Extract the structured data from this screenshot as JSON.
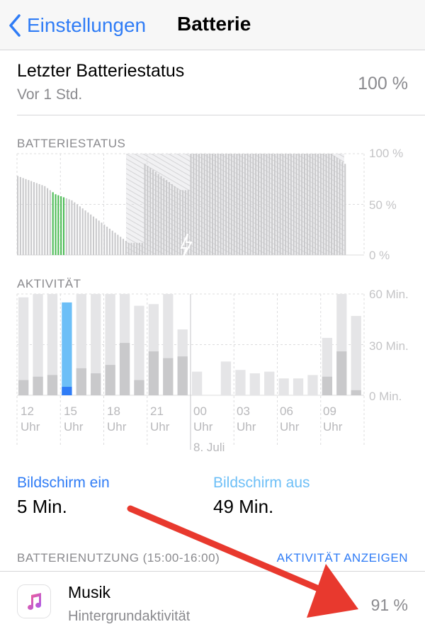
{
  "nav": {
    "back_label": "Einstellungen",
    "title": "Batterie",
    "accent": "#2f7cf6"
  },
  "last_status": {
    "title": "Letzter Batteriestatus",
    "subtitle": "Vor 1 Std.",
    "value": "100 %"
  },
  "battery_chart": {
    "label": "BATTERIESTATUS",
    "y_ticks": [
      "100 %",
      "50 %",
      "0 %"
    ]
  },
  "activity_chart": {
    "label": "AKTIVITÄT",
    "y_ticks": [
      "60 Min.",
      "30 Min.",
      "0 Min."
    ],
    "x_ticks": [
      {
        "hour": "12",
        "unit": "Uhr"
      },
      {
        "hour": "15",
        "unit": "Uhr"
      },
      {
        "hour": "18",
        "unit": "Uhr"
      },
      {
        "hour": "21",
        "unit": "Uhr"
      },
      {
        "hour": "00",
        "unit": "Uhr"
      },
      {
        "hour": "03",
        "unit": "Uhr"
      },
      {
        "hour": "06",
        "unit": "Uhr"
      },
      {
        "hour": "09",
        "unit": "Uhr"
      }
    ],
    "date_label": "8. Juli"
  },
  "chart_data": [
    {
      "type": "bar",
      "title": "BATTERIESTATUS",
      "ylim": [
        0,
        100
      ],
      "unit": "%",
      "values": [
        78,
        77,
        76,
        75,
        74,
        73,
        72,
        71,
        70,
        69,
        68,
        66,
        64,
        62,
        60,
        59,
        58,
        57,
        56,
        55,
        54,
        52,
        50,
        48,
        46,
        44,
        42,
        40,
        38,
        36,
        34,
        32,
        30,
        28,
        26,
        24,
        22,
        20,
        18,
        16,
        14,
        12,
        12,
        12,
        12,
        12,
        12,
        90,
        88,
        86,
        84,
        82,
        80,
        78,
        76,
        74,
        72,
        70,
        68,
        66,
        64,
        64,
        64,
        64,
        100,
        100,
        100,
        100,
        100,
        100,
        100,
        100,
        100,
        100,
        100,
        100,
        100,
        100,
        100,
        100,
        100,
        100,
        100,
        100,
        100,
        100,
        100,
        100,
        100,
        100,
        100,
        100,
        100,
        100,
        100,
        100,
        100,
        100,
        100,
        100,
        100,
        100,
        100,
        100,
        100,
        100,
        100,
        100,
        100,
        100,
        100,
        100,
        100,
        100,
        100,
        100,
        100,
        98,
        96,
        94,
        92,
        90
      ],
      "highlight_range": [
        13,
        17
      ],
      "highlight_color": "#4cbb55"
    },
    {
      "type": "bar",
      "title": "AKTIVITÄT",
      "ylim": [
        0,
        60
      ],
      "unit": "Min.",
      "categories": [
        "12 Uhr",
        "",
        "",
        "15 Uhr",
        "",
        "",
        "18 Uhr",
        "",
        "",
        "21 Uhr",
        "",
        "",
        "00 Uhr",
        "",
        "",
        "03 Uhr",
        "",
        "",
        "06 Uhr",
        "",
        "",
        "09 Uhr",
        "",
        ""
      ],
      "series": [
        {
          "name": "Bildschirm ein",
          "values": [
            9,
            11,
            12,
            5,
            16,
            13,
            18,
            31,
            9,
            26,
            22,
            23,
            0,
            0,
            0,
            0,
            0,
            0,
            0,
            0,
            0,
            11,
            26,
            3
          ]
        },
        {
          "name": "Bildschirm aus",
          "values": [
            49,
            49,
            48,
            50,
            44,
            47,
            42,
            29,
            44,
            28,
            38,
            16,
            14,
            0,
            20,
            15,
            13,
            14,
            10,
            10,
            12,
            23,
            34,
            44
          ]
        }
      ],
      "highlight_index": 3,
      "colors": {
        "on": "#c9c9cb",
        "off": "#e5e5e7",
        "highlight_on": "#2f7cf6",
        "highlight_off": "#6dbff7"
      }
    }
  ],
  "screen": {
    "on_label": "Bildschirm ein",
    "on_value": "5 Min.",
    "on_color": "#2f7cf6",
    "off_label": "Bildschirm aus",
    "off_value": "49 Min.",
    "off_color": "#6dbff7"
  },
  "usage": {
    "header": "BATTERIENUTZUNG (15:00-16:00)",
    "action": "AKTIVITÄT ANZEIGEN",
    "apps": [
      {
        "name": "Musik",
        "subtitle": "Hintergrundaktivität",
        "value": "91 %",
        "icon": "music-note-icon"
      }
    ]
  },
  "annotation": {
    "arrow_color": "#e8392e"
  }
}
